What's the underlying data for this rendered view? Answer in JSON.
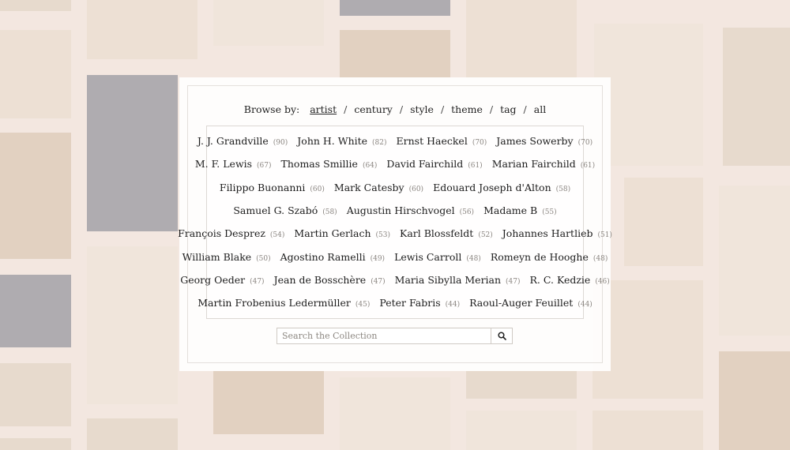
{
  "browse": {
    "label": "Browse by:",
    "options": [
      "artist",
      "century",
      "style",
      "theme",
      "tag",
      "all"
    ],
    "separator": "/"
  },
  "artists": [
    [
      {
        "name": "J. J. Grandville",
        "count": "(90)"
      },
      {
        "name": "John H. White",
        "count": "(82)"
      },
      {
        "name": "Ernst Haeckel",
        "count": "(70)"
      },
      {
        "name": "James Sowerby",
        "count": "(70)"
      }
    ],
    [
      {
        "name": "M. F. Lewis",
        "count": "(67)"
      },
      {
        "name": "Thomas Smillie",
        "count": "(64)"
      },
      {
        "name": "David Fairchild",
        "count": "(61)"
      },
      {
        "name": "Marian Fairchild",
        "count": "(61)"
      }
    ],
    [
      {
        "name": "Filippo Buonanni",
        "count": "(60)"
      },
      {
        "name": "Mark Catesby",
        "count": "(60)"
      },
      {
        "name": "Edouard Joseph d'Alton",
        "count": "(58)"
      }
    ],
    [
      {
        "name": "Samuel G. Szabó",
        "count": "(58)"
      },
      {
        "name": "Augustin Hirschvogel",
        "count": "(56)"
      },
      {
        "name": "Madame B",
        "count": "(55)"
      }
    ],
    [
      {
        "name": "François Desprez",
        "count": "(54)"
      },
      {
        "name": "Martin Gerlach",
        "count": "(53)"
      },
      {
        "name": "Karl Blossfeldt",
        "count": "(52)"
      },
      {
        "name": "Johannes Hartlieb",
        "count": "(51)"
      }
    ],
    [
      {
        "name": "William Blake",
        "count": "(50)"
      },
      {
        "name": "Agostino Ramelli",
        "count": "(49)"
      },
      {
        "name": "Lewis Carroll",
        "count": "(48)"
      },
      {
        "name": "Romeyn de Hooghe",
        "count": "(48)"
      }
    ],
    [
      {
        "name": "Georg Oeder",
        "count": "(47)"
      },
      {
        "name": "Jean de Bosschère",
        "count": "(47)"
      },
      {
        "name": "Maria Sibylla Merian",
        "count": "(47)"
      },
      {
        "name": "R. C. Kedzie",
        "count": "(46)"
      }
    ],
    [
      {
        "name": "Martin Frobenius Ledermüller",
        "count": "(45)"
      },
      {
        "name": "Peter Fabris",
        "count": "(44)"
      },
      {
        "name": "Raoul-Auger Feuillet",
        "count": "(44)"
      }
    ]
  ],
  "search": {
    "placeholder": "Search the Collection",
    "icon": "search-icon"
  },
  "colors": {
    "background": "#efe6df",
    "panel": "#ffffff",
    "text": "#1d1d1d",
    "count": "#8a8580"
  }
}
